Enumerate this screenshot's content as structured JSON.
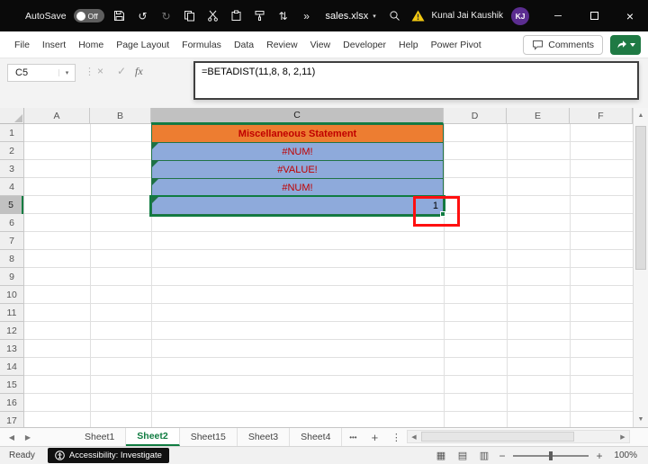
{
  "colors": {
    "excel_green": "#107C41",
    "title_fill_orange": "#ED7D31",
    "cell_fill_blue": "#8EAADB",
    "error_text_red": "#C00000",
    "annotation_red": "#FF1010",
    "avatar_purple": "#5B2D90",
    "warning_yellow": "#F2C811",
    "titlebar_black": "#0A0A0A"
  },
  "titlebar": {
    "autosave_label": "AutoSave",
    "autosave_state": "Off",
    "filename": "sales.xlsx",
    "user_name": "Kunal Jai Kaushik",
    "user_initials": "KJ"
  },
  "ribbon": {
    "tabs": [
      "File",
      "Insert",
      "Home",
      "Page Layout",
      "Formulas",
      "Data",
      "Review",
      "View",
      "Developer",
      "Help",
      "Power Pivot"
    ],
    "comments_label": "Comments"
  },
  "formula_bar": {
    "name_box": "C5",
    "fx_label": "fx",
    "formula": "=BETADIST(11,8, 8, 2,11)"
  },
  "grid": {
    "columns": [
      "A",
      "B",
      "C",
      "D",
      "E",
      "F"
    ],
    "rows": [
      "1",
      "2",
      "3",
      "4",
      "5",
      "6",
      "7",
      "8",
      "9",
      "10",
      "11",
      "12",
      "13",
      "14",
      "15",
      "16",
      "17"
    ],
    "selected_cell": "C5",
    "cells": [
      {
        "ref": "C1",
        "text": "Miscellaneous Statement"
      },
      {
        "ref": "C2",
        "text": "#NUM!"
      },
      {
        "ref": "C3",
        "text": "#VALUE!"
      },
      {
        "ref": "C4",
        "text": "#NUM!"
      },
      {
        "ref": "C5",
        "text": "1"
      }
    ]
  },
  "sheet_tabs": {
    "tabs": [
      {
        "label": "Sheet1"
      },
      {
        "label": "Sheet2"
      },
      {
        "label": "Sheet15"
      },
      {
        "label": "Sheet3"
      },
      {
        "label": "Sheet4"
      }
    ],
    "active": "Sheet2"
  },
  "status_bar": {
    "ready": "Ready",
    "accessibility": "Accessibility: Investigate",
    "zoom": "100%"
  },
  "icons": {
    "undo": "↺",
    "redo": "↻",
    "sort": "⇅",
    "overflow": "»",
    "chevron_down": "▾",
    "dots_separator": "⋮",
    "cancel": "×",
    "enter": "✓",
    "minimize": "─",
    "close": "×",
    "scroll_up": "▲",
    "scroll_down": "▼",
    "scroll_left": "◀",
    "scroll_right": "▶",
    "tab_nav_left": "◀",
    "tab_nav_right": "▶",
    "more_sheets": "•••",
    "new_sheet": "+",
    "sheet_menu": "⋮",
    "view_normal": "▦",
    "view_page_layout": "▤",
    "view_page_break": "▥",
    "zoom_out": "−",
    "zoom_in": "+"
  }
}
